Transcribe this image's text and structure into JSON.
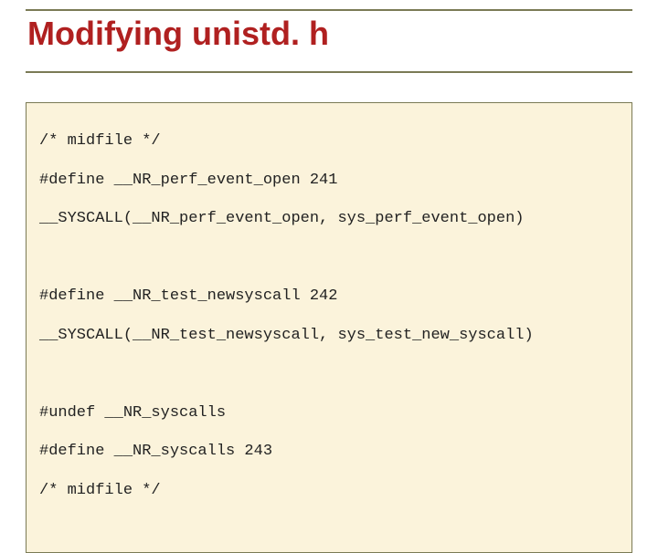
{
  "title": "Modifying unistd. h",
  "code": {
    "l1": "/* midfile */",
    "l2": "#define __NR_perf_event_open 241",
    "l3": "__SYSCALL(__NR_perf_event_open, sys_perf_event_open)",
    "l4": "#define __NR_test_newsyscall 242",
    "l5": "__SYSCALL(__NR_test_newsyscall, sys_test_new_syscall)",
    "l6": "#undef __NR_syscalls",
    "l7": "#define __NR_syscalls 243",
    "l8": "/* midfile */"
  }
}
